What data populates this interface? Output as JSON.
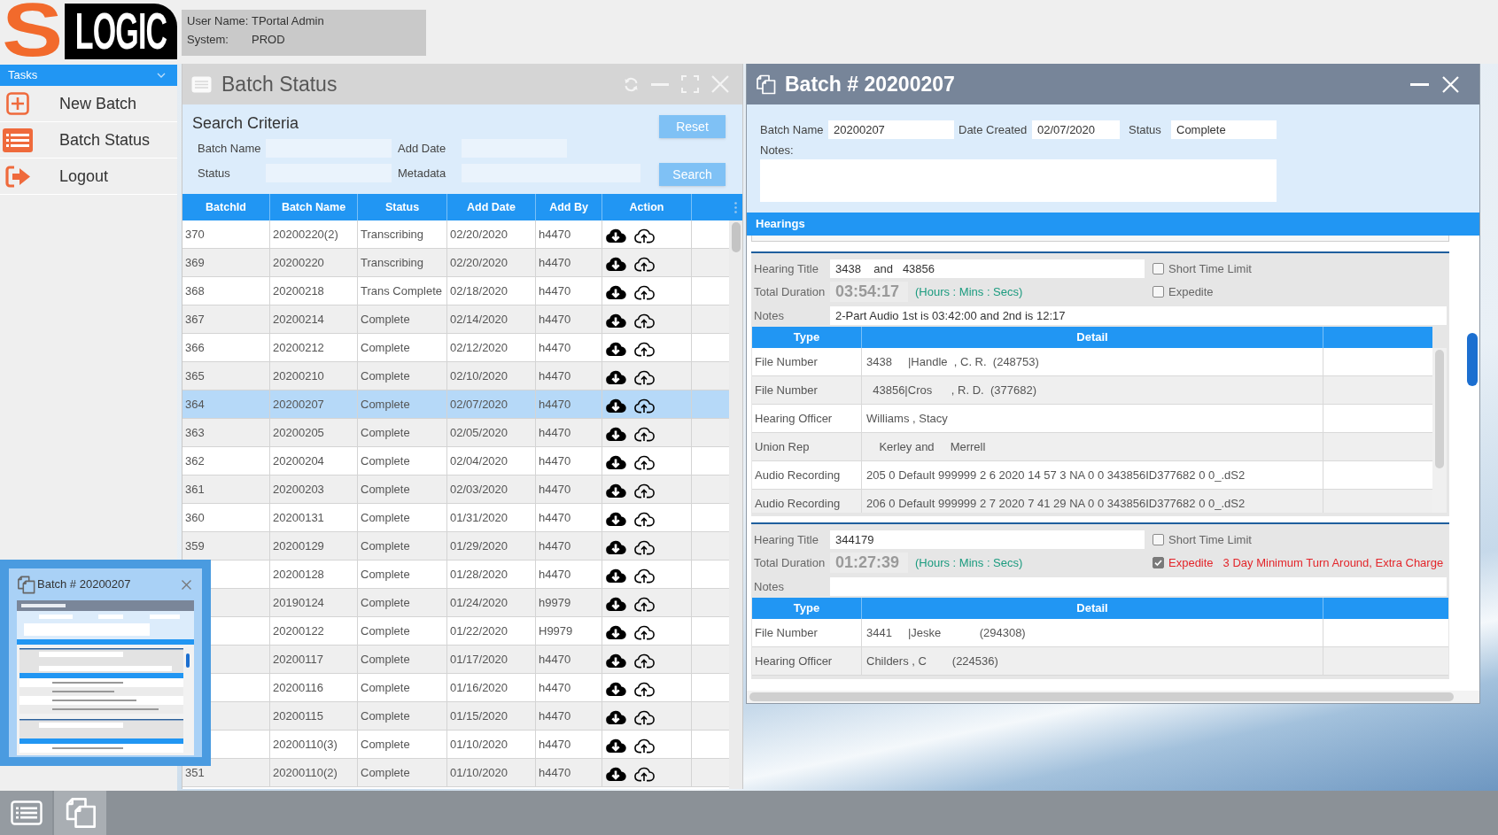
{
  "logo": {
    "letter": "S",
    "word": "LOGIC"
  },
  "user_info": [
    {
      "label": "User Name:",
      "value": "TPortal Admin"
    },
    {
      "label": "System:",
      "value": "PROD"
    }
  ],
  "sidebar": {
    "header": "Tasks",
    "items": [
      {
        "kind": "add",
        "label": "New Batch"
      },
      {
        "kind": "list",
        "label": "Batch Status"
      },
      {
        "kind": "logout",
        "label": "Logout"
      }
    ]
  },
  "batch_status_window": {
    "title": "Batch Status",
    "search": {
      "heading": "Search Criteria",
      "fields": [
        {
          "label": "Batch Name"
        },
        {
          "label": "Add Date"
        },
        {
          "label": "Status"
        },
        {
          "label": "Metadata"
        }
      ],
      "buttons": [
        "Reset",
        "Search"
      ]
    },
    "table": {
      "columns": [
        "BatchId",
        "Batch Name",
        "Status",
        "Add Date",
        "Add By",
        "Action"
      ],
      "rows": [
        {
          "batch_id": "370",
          "batch_name": "20200220(2)",
          "status": "Transcribing",
          "add_date": "02/20/2020",
          "add_by": "h4470",
          "selected": false
        },
        {
          "batch_id": "369",
          "batch_name": "20200220",
          "status": "Transcribing",
          "add_date": "02/20/2020",
          "add_by": "h4470",
          "selected": false
        },
        {
          "batch_id": "368",
          "batch_name": "20200218",
          "status": "Trans Complete",
          "add_date": "02/18/2020",
          "add_by": "h4470",
          "selected": false
        },
        {
          "batch_id": "367",
          "batch_name": "20200214",
          "status": "Complete",
          "add_date": "02/14/2020",
          "add_by": "h4470",
          "selected": false
        },
        {
          "batch_id": "366",
          "batch_name": "20200212",
          "status": "Complete",
          "add_date": "02/12/2020",
          "add_by": "h4470",
          "selected": false
        },
        {
          "batch_id": "365",
          "batch_name": "20200210",
          "status": "Complete",
          "add_date": "02/10/2020",
          "add_by": "h4470",
          "selected": false
        },
        {
          "batch_id": "364",
          "batch_name": "20200207",
          "status": "Complete",
          "add_date": "02/07/2020",
          "add_by": "h4470",
          "selected": true
        },
        {
          "batch_id": "363",
          "batch_name": "20200205",
          "status": "Complete",
          "add_date": "02/05/2020",
          "add_by": "h4470",
          "selected": false
        },
        {
          "batch_id": "362",
          "batch_name": "20200204",
          "status": "Complete",
          "add_date": "02/04/2020",
          "add_by": "h4470",
          "selected": false
        },
        {
          "batch_id": "361",
          "batch_name": "20200203",
          "status": "Complete",
          "add_date": "02/03/2020",
          "add_by": "h4470",
          "selected": false
        },
        {
          "batch_id": "360",
          "batch_name": "20200131",
          "status": "Complete",
          "add_date": "01/31/2020",
          "add_by": "h4470",
          "selected": false
        },
        {
          "batch_id": "359",
          "batch_name": "20200129",
          "status": "Complete",
          "add_date": "01/29/2020",
          "add_by": "h4470",
          "selected": false
        },
        {
          "batch_name": "20200128",
          "status": "Complete",
          "add_date": "01/28/2020",
          "add_by": "h4470",
          "selected": false
        },
        {
          "batch_name": "20190124",
          "status": "Complete",
          "add_date": "01/24/2020",
          "add_by": "h9979",
          "selected": false
        },
        {
          "batch_name": "20200122",
          "status": "Complete",
          "add_date": "01/22/2020",
          "add_by": "H9979",
          "selected": false
        },
        {
          "batch_name": "20200117",
          "status": "Complete",
          "add_date": "01/17/2020",
          "add_by": "h4470",
          "selected": false
        },
        {
          "batch_name": "20200116",
          "status": "Complete",
          "add_date": "01/16/2020",
          "add_by": "h4470",
          "selected": false
        },
        {
          "batch_name": "20200115",
          "status": "Complete",
          "add_date": "01/15/2020",
          "add_by": "h4470",
          "selected": false
        },
        {
          "batch_name": "20200110(3)",
          "status": "Complete",
          "add_date": "01/10/2020",
          "add_by": "h4470",
          "selected": false
        },
        {
          "batch_id": "351",
          "batch_name": "20200110(2)",
          "status": "Complete",
          "add_date": "01/10/2020",
          "add_by": "h4470",
          "selected": false
        }
      ]
    }
  },
  "batch_window": {
    "title": "Batch # 20200207",
    "fields": [
      {
        "label": "Batch Name",
        "value": "20200207"
      },
      {
        "label": "Date Created",
        "value": "02/07/2020"
      },
      {
        "label": "Status",
        "value": "Complete"
      }
    ],
    "notes_label": "Notes:",
    "section": "Hearings",
    "hearings": [
      {
        "title_label": "Hearing Title",
        "title": "3438    and   43856",
        "duration_label": "Total Duration",
        "duration": "03:54:17",
        "duration_unit": "(Hours : Mins : Secs)",
        "notes_label": "Notes",
        "notes": "2-Part Audio 1st is 03:42:00 and 2nd is 12:17",
        "options": [
          {
            "label": "Short Time Limit",
            "checked": false
          },
          {
            "label": "Expedite",
            "checked": false
          }
        ],
        "columns": [
          "Type",
          "Detail"
        ],
        "rows": [
          {
            "type": "File Number",
            "detail": "3438     |Handle  , C. R.  (248753)"
          },
          {
            "type": "File Number",
            "detail": "  43856|Cros      , R. D.  (377682)"
          },
          {
            "type": "Hearing Officer",
            "detail": "Williams , Stacy"
          },
          {
            "type": "Union Rep",
            "detail": "    Kerley and     Merrell"
          },
          {
            "type": "Audio Recording",
            "detail": "205 0 Default 999999 2 6 2020 14 57 3 NA 0 0 343856ID377682 0 0_.dS2"
          },
          {
            "type": "Audio Recording",
            "detail": "206 0 Default 999999 2 7 2020 7 41 29 NA 0 0 343856ID377682 0 0_.dS2"
          }
        ]
      },
      {
        "title_label": "Hearing Title",
        "title": "344179",
        "duration_label": "Total Duration",
        "duration": "01:27:39",
        "duration_unit": "(Hours : Mins : Secs)",
        "notes_label": "Notes",
        "options": [
          {
            "label": "Short Time Limit",
            "checked": false
          },
          {
            "label": "Expedite",
            "checked": true,
            "note": "3 Day Minimum Turn Around, Extra Charge"
          }
        ],
        "columns": [
          "Type",
          "Detail"
        ],
        "rows": [
          {
            "type": "File Number",
            "detail": "3441     |Jeske            (294308)"
          },
          {
            "type": "Hearing Officer",
            "detail": "Childers , C        (224536)"
          }
        ]
      }
    ]
  },
  "preview": {
    "title": "Batch # 20200207"
  },
  "taskbar": {
    "items": [
      {
        "kind": "list",
        "selected": false
      },
      {
        "kind": "copy",
        "selected": true
      }
    ]
  }
}
